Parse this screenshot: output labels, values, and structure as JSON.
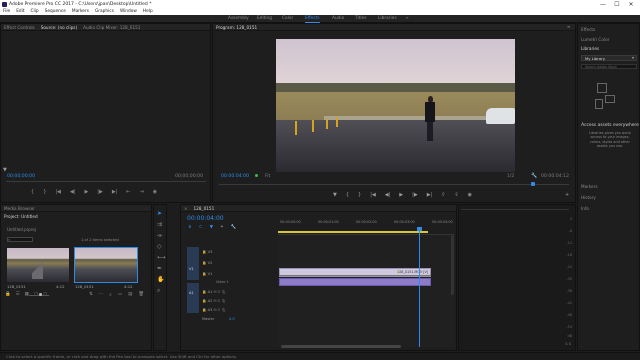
{
  "window": {
    "title": "Adobe Premiere Pro CC 2017 - C:\\Users\\jpan\\Desktop\\Untitled *",
    "minimize": "—",
    "maximize": "☐",
    "close": "✕"
  },
  "menu": [
    "File",
    "Edit",
    "Clip",
    "Sequence",
    "Markers",
    "Graphics",
    "Window",
    "Help"
  ],
  "workspaces": [
    "Assembly",
    "Editing",
    "Color",
    "Effects",
    "Audio",
    "Titles",
    "Libraries"
  ],
  "active_workspace": "Effects",
  "source_panel": {
    "tabs": [
      "Effect Controls",
      "Source: (no clips)",
      "Audio Clip Mixer: 128_0151"
    ],
    "timecode_left": "00;00;00;00",
    "timecode_right": "00;00;00;00"
  },
  "program_panel": {
    "tab": "Program: 128_0151",
    "timecode": "00:00:04:00",
    "fit": "Fit",
    "zoom": "1/2",
    "duration": "00:00:04:12"
  },
  "project_panel": {
    "tabs": [
      "Media Browser",
      "Project: Untitled"
    ],
    "project_file": "Untitled.prproj",
    "selection_info": "1 of 2 items selected",
    "items": [
      {
        "name": "128_0151",
        "duration": "4:12"
      },
      {
        "name": "128_0151",
        "duration": "4:12"
      }
    ]
  },
  "timeline": {
    "tab": "128_0151",
    "timecode": "00:00:04:00",
    "ruler": [
      "00:00:00:00",
      "00:00:01:00",
      "00:00:02:00",
      "00:00:03:00",
      "00:00:04:00",
      "00:00:05:00"
    ],
    "video_tracks": [
      "V3",
      "V2",
      "V1"
    ],
    "audio_tracks": [
      "A1",
      "A2",
      "A3"
    ],
    "v1_label": "Video 1",
    "master_label": "Master",
    "master_value": "0.0",
    "clip_name": "128_0151.MOV [V]",
    "playhead_fraction": 0.8
  },
  "audio_meter": {
    "ticks": [
      "0",
      "-6",
      "-12",
      "-18",
      "-24",
      "-30",
      "-36",
      "-42",
      "-48",
      "-54",
      "dB"
    ],
    "solo": "S S"
  },
  "right_panel": {
    "effects": "Effects",
    "lumetri": "Lumetri Color",
    "libraries": "Libraries",
    "library_name": "My Library",
    "search_placeholder": "Search Adobe Stock",
    "access_title": "Access assets everywhere",
    "access_body": "Libraries gives you quick access to your images, colors, styles and other assets you use.",
    "markers": "Markers",
    "history": "History",
    "info": "Info"
  },
  "status_text": "Click to select a specific frame, or click and drag with the Pen tool to marquee select. Use Shift and Ctrl for other options.",
  "colors": {
    "accent": "#2d8ceb",
    "clip_video": "#cfc9df",
    "clip_audio": "#8c7cc8",
    "work_area": "#d8c63a"
  }
}
